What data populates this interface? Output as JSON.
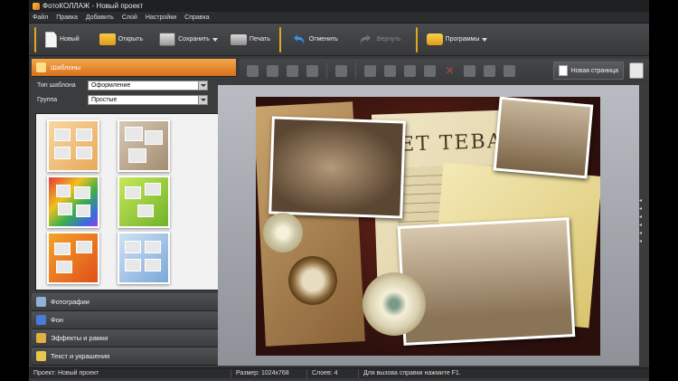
{
  "window": {
    "title": "ФотоКОЛЛАЖ - Новый проект"
  },
  "menu": [
    "Файл",
    "Правка",
    "Добавить",
    "Слой",
    "Настройки",
    "Справка"
  ],
  "toolbar": {
    "new": "Новый",
    "open": "Открыть",
    "save": "Сохранить",
    "print": "Печать",
    "undo": "Отменить",
    "redo": "Вернуть",
    "programs": "Программы"
  },
  "left_panel": {
    "templates_header": "Шаблоны",
    "template_type_label": "Тип шаблона",
    "template_type_value": "Оформление",
    "group_label": "Группа",
    "group_value": "Простые",
    "sections": [
      "Фотографии",
      "Фон",
      "Эффекты и рамки",
      "Текст и украшения"
    ]
  },
  "canvas": {
    "new_page_label": "Новая страница"
  },
  "status": {
    "project": "Проект: Новый проект",
    "size": "Размер: 1024x768",
    "layers": "Слоев: 4",
    "hint": "Для вызова справки нажмите F1."
  },
  "collage_text": {
    "heading": "ET TEBA"
  },
  "colors": {
    "accent_orange": "#e0a820",
    "active_header": "#f4a64a",
    "collage_bg": "#2a0f0c"
  }
}
